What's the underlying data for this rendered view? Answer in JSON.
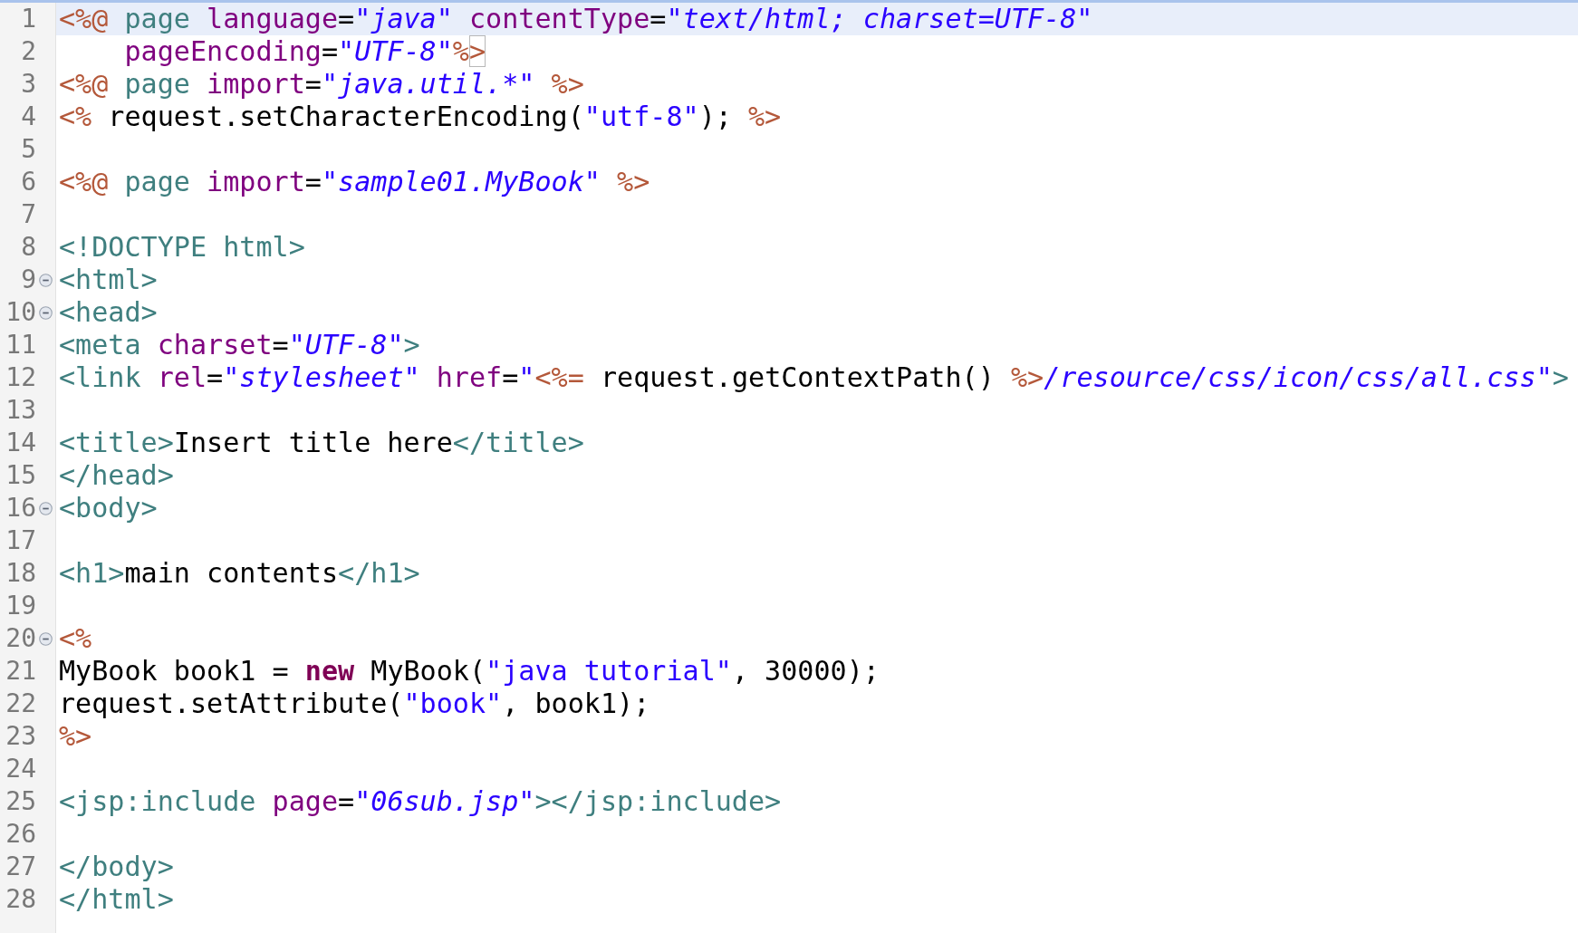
{
  "editor": {
    "lines": [
      {
        "number": "1",
        "current": true,
        "tokens": [
          {
            "kind": "jsp",
            "text": "<%@"
          },
          {
            "kind": "tag",
            "text": " page"
          },
          {
            "kind": "attr",
            "text": " language"
          },
          {
            "kind": "plain",
            "text": "="
          },
          {
            "kind": "str",
            "text": "\"java\""
          },
          {
            "kind": "attr",
            "text": " contentType"
          },
          {
            "kind": "plain",
            "text": "="
          },
          {
            "kind": "str",
            "text": "\"text/html; charset=UTF-8\""
          }
        ]
      },
      {
        "number": "2",
        "current": false,
        "tokens": [
          {
            "kind": "attr",
            "text": "    pageEncoding"
          },
          {
            "kind": "plain",
            "text": "="
          },
          {
            "kind": "str",
            "text": "\"UTF-8\""
          },
          {
            "kind": "jsp",
            "text": "%"
          },
          {
            "kind": "jsp-match",
            "text": ">"
          }
        ]
      },
      {
        "number": "3",
        "current": false,
        "tokens": [
          {
            "kind": "jsp",
            "text": "<%@"
          },
          {
            "kind": "tag",
            "text": " page"
          },
          {
            "kind": "attr",
            "text": " import"
          },
          {
            "kind": "plain",
            "text": "="
          },
          {
            "kind": "str",
            "text": "\"java.util.*\""
          },
          {
            "kind": "jsp",
            "text": " %>"
          }
        ]
      },
      {
        "number": "4",
        "current": false,
        "tokens": [
          {
            "kind": "jsp",
            "text": "<%"
          },
          {
            "kind": "plain",
            "text": " request.setCharacterEncoding("
          },
          {
            "kind": "java-string",
            "text": "\"utf-8\""
          },
          {
            "kind": "plain",
            "text": "); "
          },
          {
            "kind": "jsp",
            "text": "%>"
          }
        ]
      },
      {
        "number": "5",
        "current": false
      },
      {
        "number": "6",
        "current": false,
        "tokens": [
          {
            "kind": "jsp",
            "text": "<%@"
          },
          {
            "kind": "tag",
            "text": " page"
          },
          {
            "kind": "attr",
            "text": " import"
          },
          {
            "kind": "plain",
            "text": "="
          },
          {
            "kind": "str",
            "text": "\"sample01.MyBook\""
          },
          {
            "kind": "jsp",
            "text": " %>"
          }
        ]
      },
      {
        "number": "7",
        "current": false
      },
      {
        "number": "8",
        "current": false,
        "tokens": [
          {
            "kind": "tag",
            "text": "<!DOCTYPE html>"
          }
        ]
      },
      {
        "number": "9",
        "current": false,
        "expanded": true,
        "tokens": [
          {
            "kind": "tag",
            "text": "<html>"
          }
        ]
      },
      {
        "number": "10",
        "current": false,
        "expanded": true,
        "tokens": [
          {
            "kind": "tag",
            "text": "<head>"
          }
        ]
      },
      {
        "number": "11",
        "current": false,
        "tokens": [
          {
            "kind": "tag",
            "text": "<meta"
          },
          {
            "kind": "attr",
            "text": " charset"
          },
          {
            "kind": "plain",
            "text": "="
          },
          {
            "kind": "str",
            "text": "\"UTF-8\""
          },
          {
            "kind": "tag",
            "text": ">"
          }
        ]
      },
      {
        "number": "12",
        "current": false,
        "tokens": [
          {
            "kind": "tag",
            "text": "<link"
          },
          {
            "kind": "attr",
            "text": " rel"
          },
          {
            "kind": "plain",
            "text": "="
          },
          {
            "kind": "str",
            "text": "\"stylesheet\""
          },
          {
            "kind": "attr",
            "text": " href"
          },
          {
            "kind": "plain",
            "text": "="
          },
          {
            "kind": "str",
            "text": "\""
          },
          {
            "kind": "jsp",
            "text": "<%="
          },
          {
            "kind": "plain",
            "text": " request.getContextPath() "
          },
          {
            "kind": "jsp",
            "text": "%>"
          },
          {
            "kind": "str",
            "text": "/resource/css/icon/css/all.css\""
          },
          {
            "kind": "tag",
            "text": ">"
          }
        ]
      },
      {
        "number": "13",
        "current": false
      },
      {
        "number": "14",
        "current": false,
        "tokens": [
          {
            "kind": "tag",
            "text": "<title>"
          },
          {
            "kind": "plain",
            "text": "Insert title here"
          },
          {
            "kind": "tag",
            "text": "</title>"
          }
        ]
      },
      {
        "number": "15",
        "current": false,
        "tokens": [
          {
            "kind": "tag",
            "text": "</head>"
          }
        ]
      },
      {
        "number": "16",
        "current": false,
        "expanded": true,
        "tokens": [
          {
            "kind": "tag",
            "text": "<body>"
          }
        ]
      },
      {
        "number": "17",
        "current": false
      },
      {
        "number": "18",
        "current": false,
        "tokens": [
          {
            "kind": "tag",
            "text": "<h1>"
          },
          {
            "kind": "plain",
            "text": "main contents"
          },
          {
            "kind": "tag",
            "text": "</h1>"
          }
        ]
      },
      {
        "number": "19",
        "current": false
      },
      {
        "number": "20",
        "current": false,
        "expanded": true,
        "tokens": [
          {
            "kind": "jsp",
            "text": "<%"
          }
        ]
      },
      {
        "number": "21",
        "current": false,
        "tokens": [
          {
            "kind": "plain",
            "text": "MyBook book1 = "
          },
          {
            "kind": "keyword",
            "text": "new"
          },
          {
            "kind": "plain",
            "text": " MyBook("
          },
          {
            "kind": "java-string",
            "text": "\"java tutorial\""
          },
          {
            "kind": "plain",
            "text": ", 30000);"
          }
        ]
      },
      {
        "number": "22",
        "current": false,
        "tokens": [
          {
            "kind": "plain",
            "text": "request.setAttribute("
          },
          {
            "kind": "java-string",
            "text": "\"book\""
          },
          {
            "kind": "plain",
            "text": ", book1);"
          }
        ]
      },
      {
        "number": "23",
        "current": false,
        "tokens": [
          {
            "kind": "jsp",
            "text": "%>"
          }
        ]
      },
      {
        "number": "24",
        "current": false
      },
      {
        "number": "25",
        "current": false,
        "tokens": [
          {
            "kind": "tag",
            "text": "<jsp:include"
          },
          {
            "kind": "attr",
            "text": " page"
          },
          {
            "kind": "plain",
            "text": "="
          },
          {
            "kind": "str",
            "text": "\"06sub.jsp\""
          },
          {
            "kind": "tag",
            "text": "></jsp:include>"
          }
        ]
      },
      {
        "number": "26",
        "current": false
      },
      {
        "number": "27",
        "current": false,
        "tokens": [
          {
            "kind": "tag",
            "text": "</body>"
          }
        ]
      },
      {
        "number": "28",
        "current": false,
        "tokens": [
          {
            "kind": "tag",
            "text": "</html>"
          }
        ]
      }
    ]
  }
}
